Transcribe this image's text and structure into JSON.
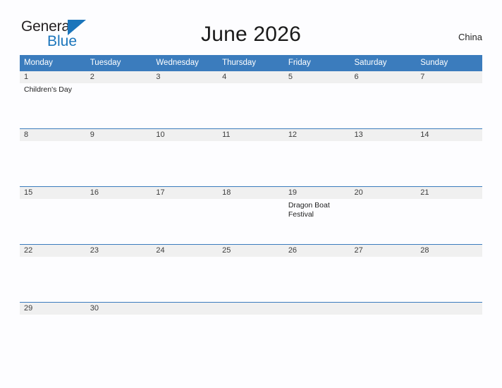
{
  "brand": {
    "name_part1": "General",
    "name_part2": "Blue",
    "triangle_icon": "blue-triangle-icon",
    "accent_color": "#1b75bb"
  },
  "header": {
    "title": "June 2026",
    "region": "China"
  },
  "colors": {
    "header_blue": "#3b7cbd",
    "date_band_gray": "#f0f0f0",
    "page_background": "#fdfdff",
    "text_dark": "#1a1a1a"
  },
  "calendar": {
    "month": "June",
    "year": "2026",
    "weekday_headers": [
      "Monday",
      "Tuesday",
      "Wednesday",
      "Thursday",
      "Friday",
      "Saturday",
      "Sunday"
    ],
    "weeks": [
      {
        "days": [
          {
            "num": "1",
            "events": [
              "Children's Day"
            ]
          },
          {
            "num": "2",
            "events": []
          },
          {
            "num": "3",
            "events": []
          },
          {
            "num": "4",
            "events": []
          },
          {
            "num": "5",
            "events": []
          },
          {
            "num": "6",
            "events": []
          },
          {
            "num": "7",
            "events": []
          }
        ]
      },
      {
        "days": [
          {
            "num": "8",
            "events": []
          },
          {
            "num": "9",
            "events": []
          },
          {
            "num": "10",
            "events": []
          },
          {
            "num": "11",
            "events": []
          },
          {
            "num": "12",
            "events": []
          },
          {
            "num": "13",
            "events": []
          },
          {
            "num": "14",
            "events": []
          }
        ]
      },
      {
        "days": [
          {
            "num": "15",
            "events": []
          },
          {
            "num": "16",
            "events": []
          },
          {
            "num": "17",
            "events": []
          },
          {
            "num": "18",
            "events": []
          },
          {
            "num": "19",
            "events": [
              "Dragon Boat Festival"
            ]
          },
          {
            "num": "20",
            "events": []
          },
          {
            "num": "21",
            "events": []
          }
        ]
      },
      {
        "days": [
          {
            "num": "22",
            "events": []
          },
          {
            "num": "23",
            "events": []
          },
          {
            "num": "24",
            "events": []
          },
          {
            "num": "25",
            "events": []
          },
          {
            "num": "26",
            "events": []
          },
          {
            "num": "27",
            "events": []
          },
          {
            "num": "28",
            "events": []
          }
        ]
      },
      {
        "days": [
          {
            "num": "29",
            "events": []
          },
          {
            "num": "30",
            "events": []
          },
          {
            "num": "",
            "events": []
          },
          {
            "num": "",
            "events": []
          },
          {
            "num": "",
            "events": []
          },
          {
            "num": "",
            "events": []
          },
          {
            "num": "",
            "events": []
          }
        ]
      }
    ]
  }
}
